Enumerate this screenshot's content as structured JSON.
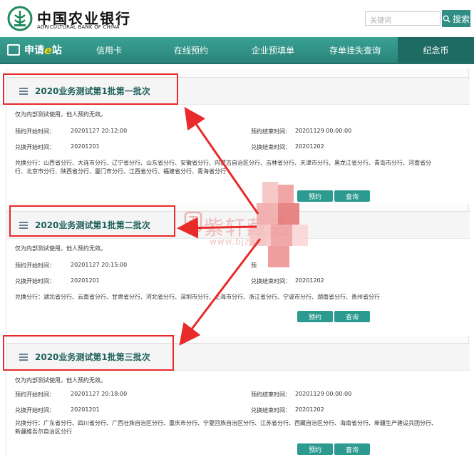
{
  "header": {
    "logo_cn": "中国农业银行",
    "logo_en": "AGRICULTURAL BANK OF CHINA",
    "search_placeholder": "关键词",
    "search_button": "搜索"
  },
  "nav": {
    "brand_prefix": "申请",
    "brand_e": "e",
    "brand_suffix": "站",
    "items": [
      "信用卡",
      "在线预约",
      "企业预填单",
      "存单挂失查询",
      "纪念币"
    ]
  },
  "sections": [
    {
      "title": "2020业务测试第1批第一批次",
      "notice": "仅为内部测试使用，他人预约无效。",
      "appt_start_label": "预约开始时间：",
      "appt_start": "20201127 20:12:00",
      "appt_end_label": "预约结束时间：",
      "appt_end": "20201129 00:00:00",
      "exch_start_label": "兑换开始时间：",
      "exch_start": "20201201",
      "exch_end_label": "兑换结束时间：",
      "exch_end": "20201202",
      "branches_label": "兑换分行：",
      "branches_line1": "山西省分行、大连市分行、辽宁省分行、山东省分行、安徽省分行、内蒙古自治区分行、吉林省分行、天津市分行、黑龙江省分行、青岛市分行、河南省分",
      "branches_line2": "行、北京市分行、陕西省分行、厦门市分行、江西省分行、福建省分行、青海省分行",
      "btn_reserve": "预约",
      "btn_query": "查询"
    },
    {
      "title": "2020业务测试第1批第二批次",
      "notice": "仅为内部测试使用，他人预约无效。",
      "appt_start_label": "预约开始时间：",
      "appt_start": "20201127 20:15:00",
      "appt_end_label": "预",
      "appt_end": "",
      "exch_start_label": "兑换开始时间：",
      "exch_start": "20201201",
      "exch_end_label": "兑换结束时间：",
      "exch_end": "20201202",
      "branches_label": "兑换分行：",
      "branches_line1": "湖北省分行、云南省分行、甘肃省分行、河北省分行、深圳市分行、上海市分行、浙江省分行、宁波市分行、湖南省分行、贵州省分行",
      "branches_line2": "",
      "btn_reserve": "预约",
      "btn_query": "查询"
    },
    {
      "title": "2020业务测试第1批第三批次",
      "notice": "仅为内部测试使用，他人预约无效。",
      "appt_start_label": "预约开始时间：",
      "appt_start": "20201127 20:18:00",
      "appt_end_label": "预约结束时间：",
      "appt_end": "20201129 00:00:00",
      "exch_start_label": "兑换开始时间：",
      "exch_start": "20201201",
      "exch_end_label": "兑换结束时间：",
      "exch_end": "20201202",
      "branches_label": "兑换分行：",
      "branches_line1": "广东省分行、四川省分行、广西壮族自治区分行、重庆市分行、宁夏回族自治区分行、江苏省分行、西藏自治区分行、海南省分行、新疆生产建设兵团分行、",
      "branches_line2": "新疆维吾尔自治区分行",
      "btn_reserve": "预约",
      "btn_query": "查询"
    }
  ],
  "watermark": {
    "text": "紫轩藏品",
    "url": "www.bjzxcp.com"
  },
  "colors": {
    "brand_green": "#2f8d83",
    "title_text": "#1d5f5a",
    "annotation_red": "#e82a2a"
  }
}
